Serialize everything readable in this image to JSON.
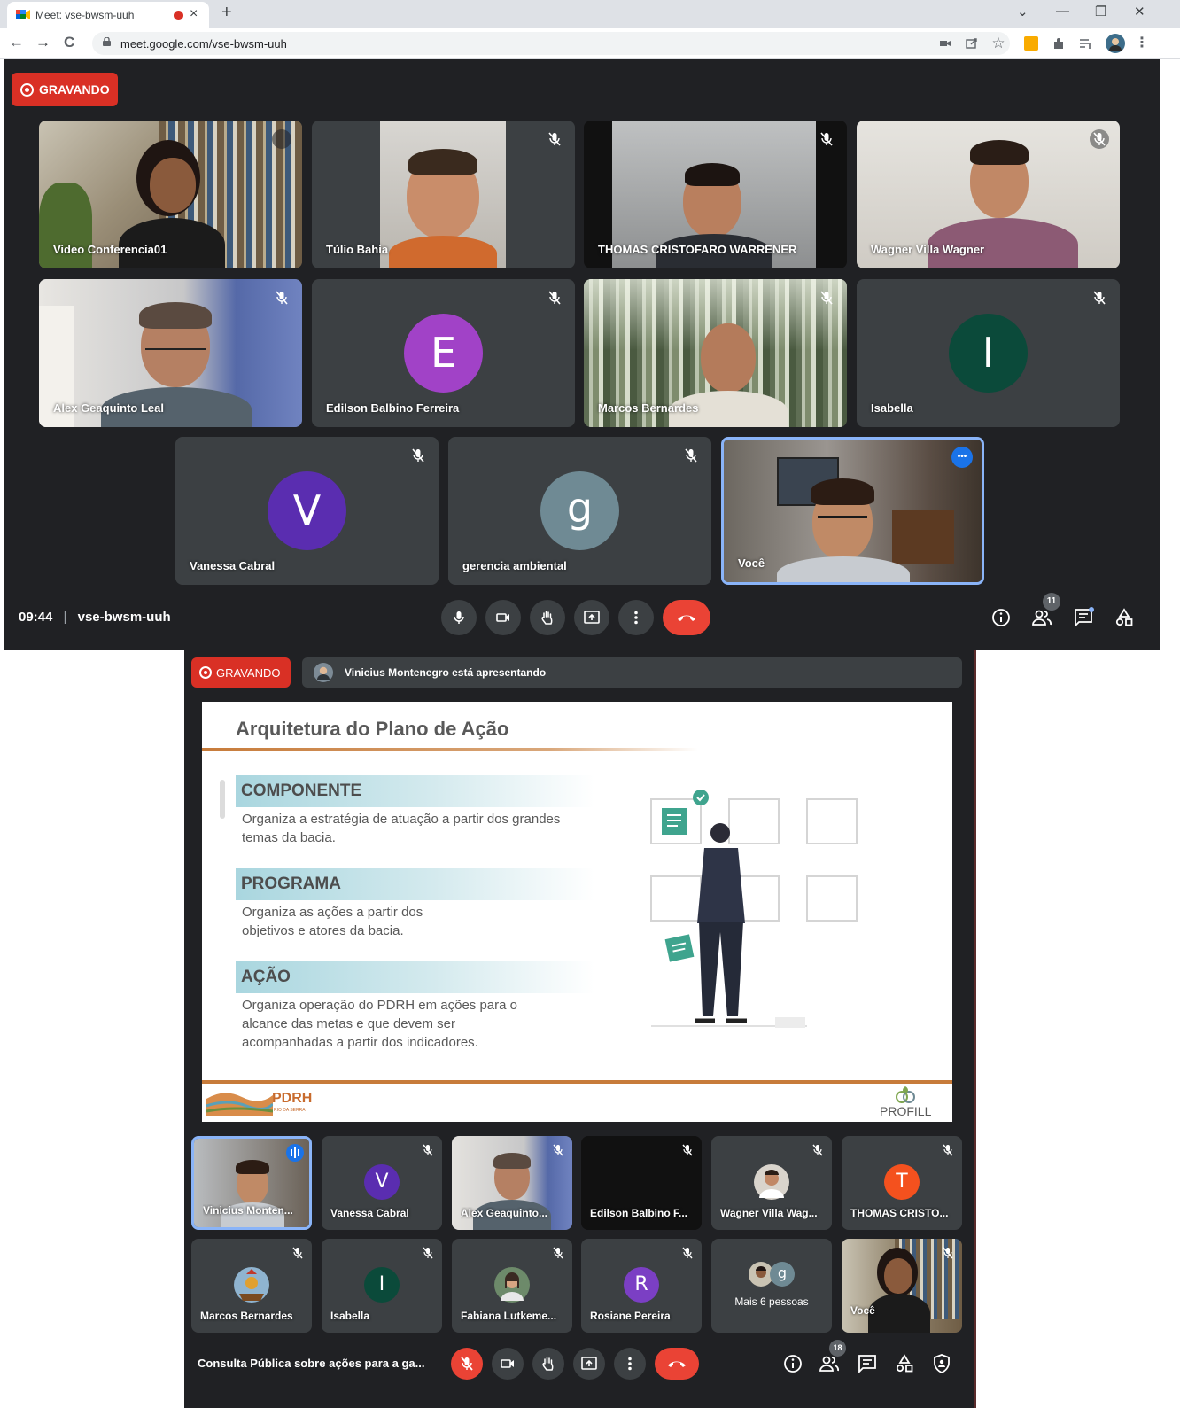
{
  "browser": {
    "tab_title": "Meet: vse-bwsm-uuh",
    "tab_close": "×",
    "new_tab": "+",
    "url": "meet.google.com/vse-bwsm-uuh",
    "win_dropdown": "⌄",
    "win_minimize": "—",
    "win_restore": "❐",
    "win_close": "✕",
    "back": "←",
    "forward": "→",
    "reload": "C",
    "star": "☆",
    "menu": "⋮"
  },
  "meet1": {
    "recording_label": "GRAVANDO",
    "time": "09:44",
    "separator": "|",
    "meeting_code": "vse-bwsm-uuh",
    "people_count": "11",
    "participants": [
      {
        "name": "Video Conferencia01"
      },
      {
        "name": "Túlio Bahia"
      },
      {
        "name": "THOMAS CRISTOFARO WARRENER"
      },
      {
        "name": "Wagner Villa Wagner"
      },
      {
        "name": "Alex Geaquinto Leal"
      },
      {
        "name": "Edilson Balbino Ferreira",
        "initial": "E"
      },
      {
        "name": "Marcos Bernardes"
      },
      {
        "name": "Isabella",
        "initial": "I"
      },
      {
        "name": "Vanessa Cabral",
        "initial": "V"
      },
      {
        "name": "gerencia ambiental",
        "initial": "g"
      },
      {
        "name": "Você"
      }
    ],
    "self_more": "•••"
  },
  "meet2": {
    "recording_label": "GRAVANDO",
    "presenting_text": "Vinicius Montenegro está apresentando",
    "slide": {
      "title": "Arquitetura do Plano de Ação",
      "sections": [
        {
          "heading": "COMPONENTE",
          "body": "Organiza a estratégia de atuação a partir dos grandes temas da bacia."
        },
        {
          "heading": "PROGRAMA",
          "body": "Organiza as ações a partir dos objetivos e atores da bacia."
        },
        {
          "heading": "AÇÃO",
          "body": "Organiza operação do PDRH em ações para o alcance das metas e que devem ser acompanhadas a partir dos indicadores."
        }
      ],
      "logo_left": "PDRH",
      "logo_left_sub": "RIO DA SERRA",
      "logo_right": "PROFILL"
    },
    "participants": [
      {
        "name": "Vinicius Monten..."
      },
      {
        "name": "Vanessa Cabral",
        "initial": "V"
      },
      {
        "name": "Alex Geaquinto..."
      },
      {
        "name": "Edilson Balbino F..."
      },
      {
        "name": "Wagner Villa Wag..."
      },
      {
        "name": "THOMAS CRISTO...",
        "initial": "T"
      },
      {
        "name": "Marcos Bernardes"
      },
      {
        "name": "Isabella",
        "initial": "I"
      },
      {
        "name": "Fabiana Lutkeme..."
      },
      {
        "name": "Rosiane Pereira",
        "initial": "R"
      },
      {
        "name": "Mais 6 pessoas",
        "initial": "g"
      },
      {
        "name": "Você"
      }
    ],
    "meeting_title": "Consulta Pública sobre ações para a ga...",
    "people_count": "18"
  },
  "colors": {
    "meet_bg": "#202124",
    "tile_bg": "#3c4043",
    "record_red": "#d93025",
    "end_call_red": "#ea4335",
    "self_border": "#8ab4f8",
    "avatar_E": "#a142c7",
    "avatar_I": "#0b4a3a",
    "avatar_V": "#5a2db0",
    "avatar_g": "#6f8a94",
    "avatar_T": "#f4511e",
    "avatar_R": "#7b3fc4",
    "slide_accent": "#c77b3a",
    "section_band": "#a9d6df"
  }
}
